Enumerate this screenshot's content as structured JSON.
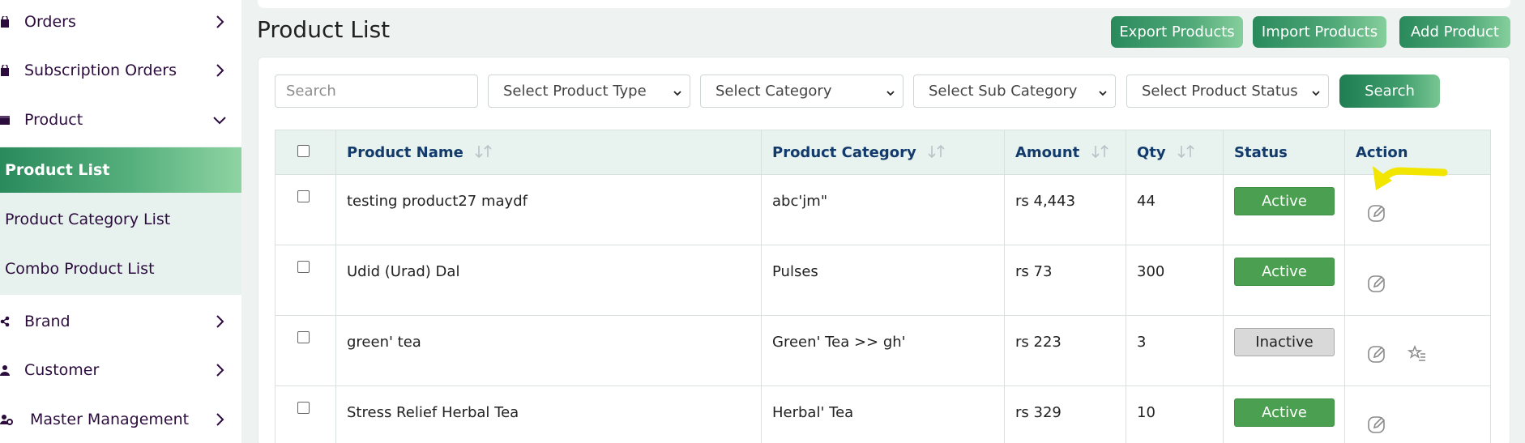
{
  "sidebar": {
    "items": [
      {
        "label": "Orders",
        "icon": "bag-icon",
        "expanded": false
      },
      {
        "label": "Subscription Orders",
        "icon": "bag-icon",
        "expanded": false
      },
      {
        "label": "Product",
        "icon": "box-icon",
        "expanded": true
      },
      {
        "label": "Brand",
        "icon": "share-icon",
        "expanded": false
      },
      {
        "label": "Customer",
        "icon": "user-icon",
        "expanded": false
      },
      {
        "label": "Master Management",
        "icon": "users-gear-icon",
        "expanded": false
      }
    ],
    "submenu": [
      {
        "label": "Product List",
        "active": true
      },
      {
        "label": "Product Category List",
        "active": false
      },
      {
        "label": "Combo Product List",
        "active": false
      }
    ]
  },
  "header": {
    "title": "Product List",
    "export_label": "Export Products",
    "import_label": "Import Products",
    "add_label": "Add Product"
  },
  "filters": {
    "search_placeholder": "Search",
    "product_type": "Select Product Type",
    "category": "Select Category",
    "sub_category": "Select Sub Category",
    "product_status": "Select Product Status",
    "search_button": "Search"
  },
  "table": {
    "columns": [
      "Product Name",
      "Product Category",
      "Amount",
      "Qty",
      "Status",
      "Action"
    ],
    "rows": [
      {
        "name": "testing product27 maydf",
        "category": "abc'jm\"",
        "amount": "rs 4,443",
        "qty": "44",
        "status": "Active"
      },
      {
        "name": "Udid (Urad) Dal",
        "category": "Pulses",
        "amount": "rs 73",
        "qty": "300",
        "status": "Active"
      },
      {
        "name": "green' tea",
        "category": "Green' Tea >> gh'",
        "amount": "rs 223",
        "qty": "3",
        "status": "Inactive"
      },
      {
        "name": "Stress Relief Herbal Tea",
        "category": "Herbal' Tea",
        "amount": "rs 329",
        "qty": "10",
        "status": "Active"
      }
    ]
  },
  "colors": {
    "accent": "#2a8a5c",
    "active_badge": "#4aa050",
    "inactive_badge": "#d9d9d9",
    "annotation": "#f2e600"
  }
}
